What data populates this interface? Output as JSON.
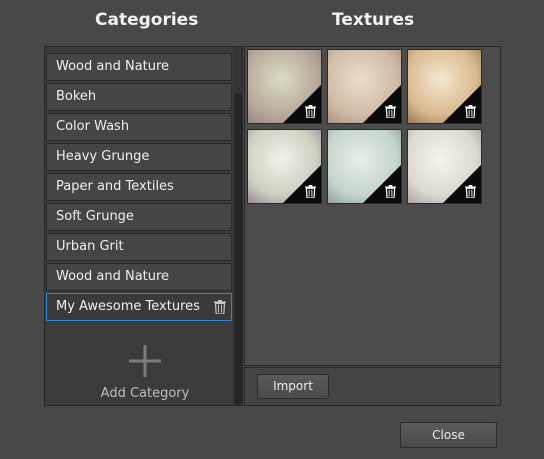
{
  "categories": {
    "title": "Categories",
    "items": [
      {
        "label": "Wood and Nature"
      },
      {
        "label": "Bokeh"
      },
      {
        "label": "Color Wash"
      },
      {
        "label": "Heavy Grunge"
      },
      {
        "label": "Paper and Textiles"
      },
      {
        "label": "Soft Grunge"
      },
      {
        "label": "Urban Grit"
      },
      {
        "label": "Wood and Nature"
      },
      {
        "label": "My Awesome Textures",
        "selected": true
      }
    ],
    "add_label": "Add Category"
  },
  "textures": {
    "title": "Textures",
    "thumbs": [
      {
        "icon": "trash-icon",
        "colors": [
          "#d9dcc4",
          "#b9a99d",
          "#7b6e72"
        ]
      },
      {
        "icon": "trash-icon",
        "colors": [
          "#eadfc9",
          "#cfbba6",
          "#8e7868"
        ]
      },
      {
        "icon": "trash-icon",
        "colors": [
          "#f5e8cf",
          "#d9b98f",
          "#6d4c2e"
        ]
      },
      {
        "icon": "trash-icon",
        "colors": [
          "#f1f2ea",
          "#cfcfc1",
          "#6e5a78"
        ]
      },
      {
        "icon": "trash-icon",
        "colors": [
          "#e9efe6",
          "#c4d5cc",
          "#6b7f7a"
        ]
      },
      {
        "icon": "trash-icon",
        "colors": [
          "#f6f3ee",
          "#ddd8d1",
          "#8a7d79"
        ]
      }
    ]
  },
  "buttons": {
    "import": "Import",
    "close": "Close"
  },
  "colors": {
    "background": "#484848",
    "selection_border": "#2f86d6"
  }
}
